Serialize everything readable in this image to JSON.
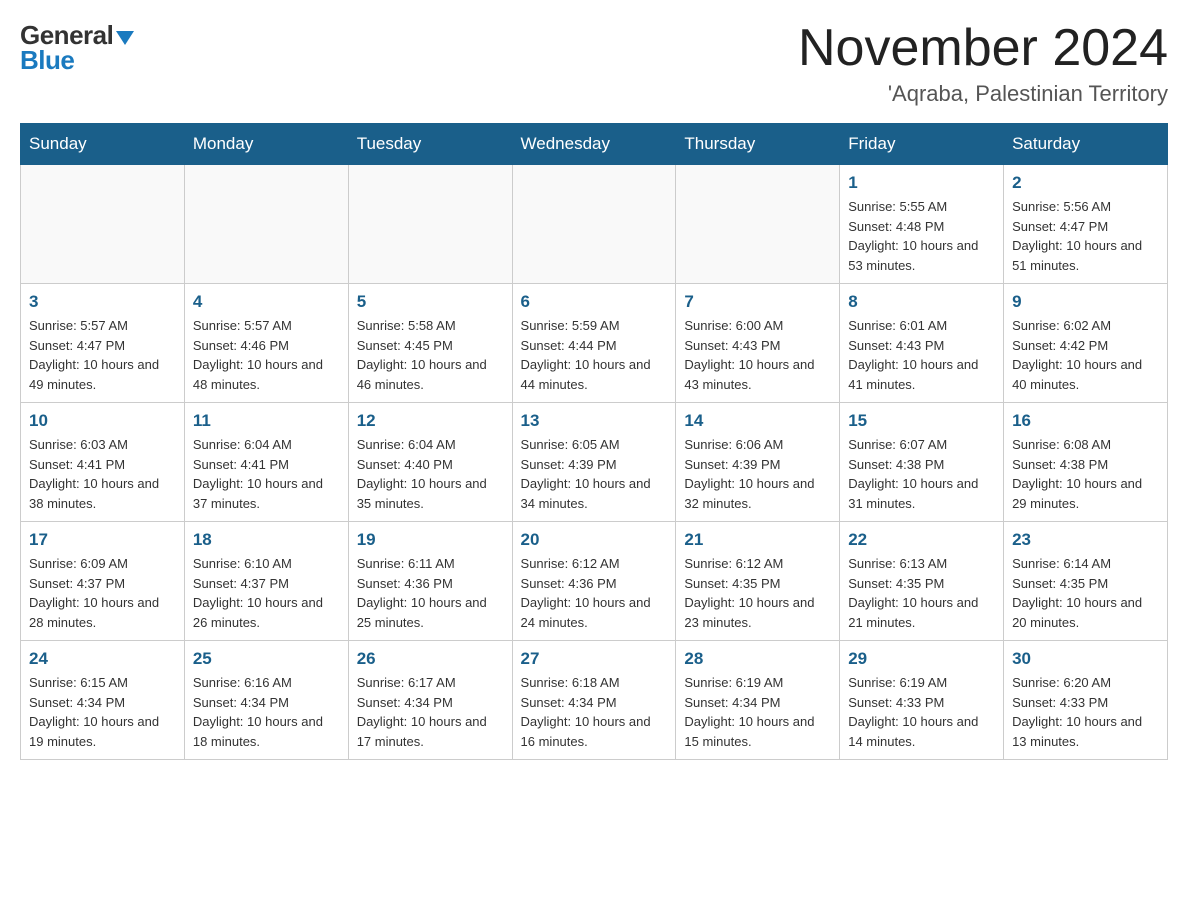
{
  "logo": {
    "general": "General",
    "blue": "Blue"
  },
  "title": "November 2024",
  "subtitle": "'Aqraba, Palestinian Territory",
  "days_of_week": [
    "Sunday",
    "Monday",
    "Tuesday",
    "Wednesday",
    "Thursday",
    "Friday",
    "Saturday"
  ],
  "weeks": [
    [
      {
        "day": "",
        "info": ""
      },
      {
        "day": "",
        "info": ""
      },
      {
        "day": "",
        "info": ""
      },
      {
        "day": "",
        "info": ""
      },
      {
        "day": "",
        "info": ""
      },
      {
        "day": "1",
        "info": "Sunrise: 5:55 AM\nSunset: 4:48 PM\nDaylight: 10 hours and 53 minutes."
      },
      {
        "day": "2",
        "info": "Sunrise: 5:56 AM\nSunset: 4:47 PM\nDaylight: 10 hours and 51 minutes."
      }
    ],
    [
      {
        "day": "3",
        "info": "Sunrise: 5:57 AM\nSunset: 4:47 PM\nDaylight: 10 hours and 49 minutes."
      },
      {
        "day": "4",
        "info": "Sunrise: 5:57 AM\nSunset: 4:46 PM\nDaylight: 10 hours and 48 minutes."
      },
      {
        "day": "5",
        "info": "Sunrise: 5:58 AM\nSunset: 4:45 PM\nDaylight: 10 hours and 46 minutes."
      },
      {
        "day": "6",
        "info": "Sunrise: 5:59 AM\nSunset: 4:44 PM\nDaylight: 10 hours and 44 minutes."
      },
      {
        "day": "7",
        "info": "Sunrise: 6:00 AM\nSunset: 4:43 PM\nDaylight: 10 hours and 43 minutes."
      },
      {
        "day": "8",
        "info": "Sunrise: 6:01 AM\nSunset: 4:43 PM\nDaylight: 10 hours and 41 minutes."
      },
      {
        "day": "9",
        "info": "Sunrise: 6:02 AM\nSunset: 4:42 PM\nDaylight: 10 hours and 40 minutes."
      }
    ],
    [
      {
        "day": "10",
        "info": "Sunrise: 6:03 AM\nSunset: 4:41 PM\nDaylight: 10 hours and 38 minutes."
      },
      {
        "day": "11",
        "info": "Sunrise: 6:04 AM\nSunset: 4:41 PM\nDaylight: 10 hours and 37 minutes."
      },
      {
        "day": "12",
        "info": "Sunrise: 6:04 AM\nSunset: 4:40 PM\nDaylight: 10 hours and 35 minutes."
      },
      {
        "day": "13",
        "info": "Sunrise: 6:05 AM\nSunset: 4:39 PM\nDaylight: 10 hours and 34 minutes."
      },
      {
        "day": "14",
        "info": "Sunrise: 6:06 AM\nSunset: 4:39 PM\nDaylight: 10 hours and 32 minutes."
      },
      {
        "day": "15",
        "info": "Sunrise: 6:07 AM\nSunset: 4:38 PM\nDaylight: 10 hours and 31 minutes."
      },
      {
        "day": "16",
        "info": "Sunrise: 6:08 AM\nSunset: 4:38 PM\nDaylight: 10 hours and 29 minutes."
      }
    ],
    [
      {
        "day": "17",
        "info": "Sunrise: 6:09 AM\nSunset: 4:37 PM\nDaylight: 10 hours and 28 minutes."
      },
      {
        "day": "18",
        "info": "Sunrise: 6:10 AM\nSunset: 4:37 PM\nDaylight: 10 hours and 26 minutes."
      },
      {
        "day": "19",
        "info": "Sunrise: 6:11 AM\nSunset: 4:36 PM\nDaylight: 10 hours and 25 minutes."
      },
      {
        "day": "20",
        "info": "Sunrise: 6:12 AM\nSunset: 4:36 PM\nDaylight: 10 hours and 24 minutes."
      },
      {
        "day": "21",
        "info": "Sunrise: 6:12 AM\nSunset: 4:35 PM\nDaylight: 10 hours and 23 minutes."
      },
      {
        "day": "22",
        "info": "Sunrise: 6:13 AM\nSunset: 4:35 PM\nDaylight: 10 hours and 21 minutes."
      },
      {
        "day": "23",
        "info": "Sunrise: 6:14 AM\nSunset: 4:35 PM\nDaylight: 10 hours and 20 minutes."
      }
    ],
    [
      {
        "day": "24",
        "info": "Sunrise: 6:15 AM\nSunset: 4:34 PM\nDaylight: 10 hours and 19 minutes."
      },
      {
        "day": "25",
        "info": "Sunrise: 6:16 AM\nSunset: 4:34 PM\nDaylight: 10 hours and 18 minutes."
      },
      {
        "day": "26",
        "info": "Sunrise: 6:17 AM\nSunset: 4:34 PM\nDaylight: 10 hours and 17 minutes."
      },
      {
        "day": "27",
        "info": "Sunrise: 6:18 AM\nSunset: 4:34 PM\nDaylight: 10 hours and 16 minutes."
      },
      {
        "day": "28",
        "info": "Sunrise: 6:19 AM\nSunset: 4:34 PM\nDaylight: 10 hours and 15 minutes."
      },
      {
        "day": "29",
        "info": "Sunrise: 6:19 AM\nSunset: 4:33 PM\nDaylight: 10 hours and 14 minutes."
      },
      {
        "day": "30",
        "info": "Sunrise: 6:20 AM\nSunset: 4:33 PM\nDaylight: 10 hours and 13 minutes."
      }
    ]
  ]
}
